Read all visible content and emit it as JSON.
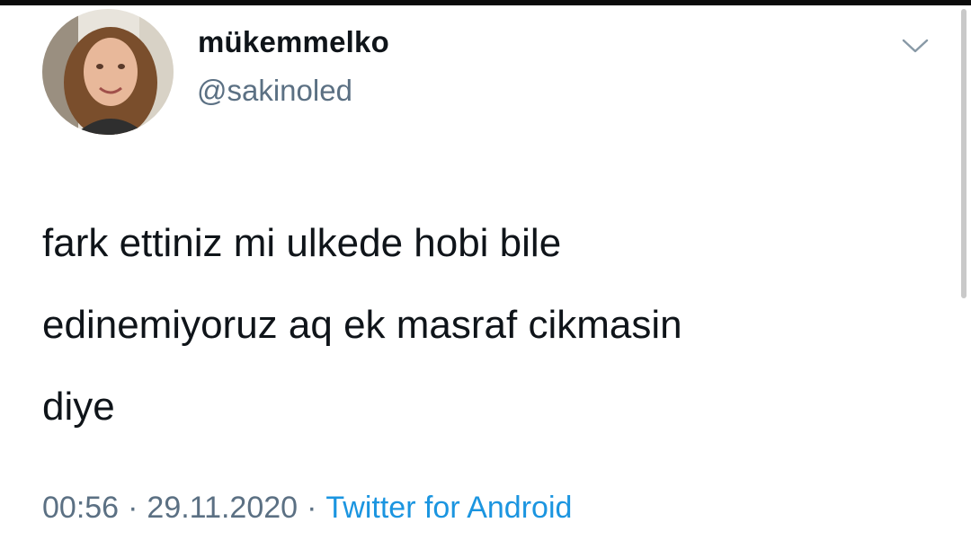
{
  "user": {
    "display_name": "mükemmelko",
    "handle": "@sakinoled"
  },
  "tweet": {
    "lines": [
      "fark ettiniz mi ulkede hobi bile",
      "edinemiyoruz aq ek masraf cikmasin",
      "diye"
    ]
  },
  "meta": {
    "time": "00:56",
    "separator": "·",
    "date": "29.11.2020",
    "source": "Twitter for Android"
  },
  "icons": {
    "more": "chevron-down-icon"
  },
  "colors": {
    "text": "#0f1419",
    "secondary": "#5b7083",
    "link": "#1b95e0"
  }
}
